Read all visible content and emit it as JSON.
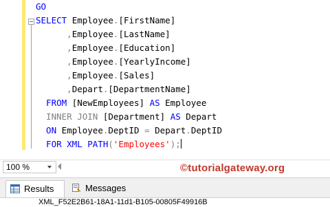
{
  "editor": {
    "lines": [
      {
        "parts": [
          {
            "text": "GO",
            "cls": "kw"
          }
        ]
      },
      {
        "parts": [
          {
            "text": "SELECT ",
            "cls": "kw"
          },
          {
            "text": "Employee",
            "cls": ""
          },
          {
            "text": ".",
            "cls": "gr"
          },
          {
            "text": "[FirstName]",
            "cls": ""
          }
        ]
      },
      {
        "parts": [
          {
            "text": "      ,",
            "cls": "gr"
          },
          {
            "text": "Employee",
            "cls": ""
          },
          {
            "text": ".",
            "cls": "gr"
          },
          {
            "text": "[LastName]",
            "cls": ""
          }
        ]
      },
      {
        "parts": [
          {
            "text": "      ,",
            "cls": "gr"
          },
          {
            "text": "Employee",
            "cls": ""
          },
          {
            "text": ".",
            "cls": "gr"
          },
          {
            "text": "[Education]",
            "cls": ""
          }
        ]
      },
      {
        "parts": [
          {
            "text": "      ,",
            "cls": "gr"
          },
          {
            "text": "Employee",
            "cls": ""
          },
          {
            "text": ".",
            "cls": "gr"
          },
          {
            "text": "[YearlyIncome]",
            "cls": ""
          }
        ]
      },
      {
        "parts": [
          {
            "text": "      ,",
            "cls": "gr"
          },
          {
            "text": "Employee",
            "cls": ""
          },
          {
            "text": ".",
            "cls": "gr"
          },
          {
            "text": "[Sales]",
            "cls": ""
          }
        ]
      },
      {
        "parts": [
          {
            "text": "      ,",
            "cls": "gr"
          },
          {
            "text": "Depart",
            "cls": ""
          },
          {
            "text": ".",
            "cls": "gr"
          },
          {
            "text": "[DepartmentName]",
            "cls": ""
          }
        ]
      },
      {
        "parts": [
          {
            "text": "  FROM ",
            "cls": "kw"
          },
          {
            "text": "[NewEmployees] ",
            "cls": ""
          },
          {
            "text": "AS ",
            "cls": "kw"
          },
          {
            "text": "Employee",
            "cls": ""
          }
        ]
      },
      {
        "parts": [
          {
            "text": "  INNER JOIN ",
            "cls": "gr"
          },
          {
            "text": "[Department] ",
            "cls": ""
          },
          {
            "text": "AS ",
            "cls": "kw"
          },
          {
            "text": "Depart",
            "cls": ""
          }
        ]
      },
      {
        "parts": [
          {
            "text": "  ON ",
            "cls": "kw"
          },
          {
            "text": "Employee",
            "cls": ""
          },
          {
            "text": ".",
            "cls": "gr"
          },
          {
            "text": "DeptID ",
            "cls": ""
          },
          {
            "text": "= ",
            "cls": "gr"
          },
          {
            "text": "Depart",
            "cls": ""
          },
          {
            "text": ".",
            "cls": "gr"
          },
          {
            "text": "DeptID",
            "cls": ""
          }
        ]
      },
      {
        "parts": [
          {
            "text": "  FOR XML PATH",
            "cls": "kw"
          },
          {
            "text": "(",
            "cls": "gr"
          },
          {
            "text": "'Employees'",
            "cls": "st"
          },
          {
            "text": ");",
            "cls": "gr"
          }
        ],
        "caret": true
      }
    ]
  },
  "zoom": {
    "value": "100 %"
  },
  "watermark": {
    "text": "©tutorialgateway.org"
  },
  "tabs": [
    {
      "label": "Results",
      "icon": "results-grid-icon"
    },
    {
      "label": "Messages",
      "icon": "messages-icon"
    }
  ],
  "result": {
    "value": "XML_F52E2B61-18A1-11d1-B105-00805F49916B"
  }
}
